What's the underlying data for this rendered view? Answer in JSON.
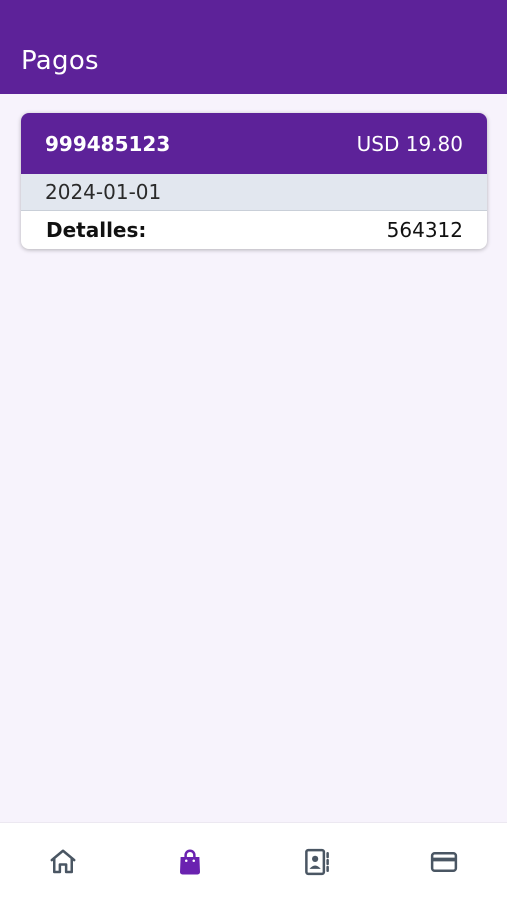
{
  "app_bar": {
    "title": "Pagos"
  },
  "payments": [
    {
      "id": "999485123",
      "amount": "USD 19.80",
      "date": "2024-01-01",
      "details_label": "Detalles:",
      "details_value": "564312"
    }
  ],
  "bottom_nav": {
    "items": [
      {
        "icon": "home-icon",
        "active": false
      },
      {
        "icon": "shopping-bag-icon",
        "active": true
      },
      {
        "icon": "contacts-book-icon",
        "active": false
      },
      {
        "icon": "credit-card-icon",
        "active": false
      }
    ]
  },
  "colors": {
    "primary": "#5d2299",
    "background": "#f7f3fc",
    "date_row": "#e2e7ef",
    "nav_active": "#6a22b0",
    "nav_inactive": "#4a5663"
  }
}
